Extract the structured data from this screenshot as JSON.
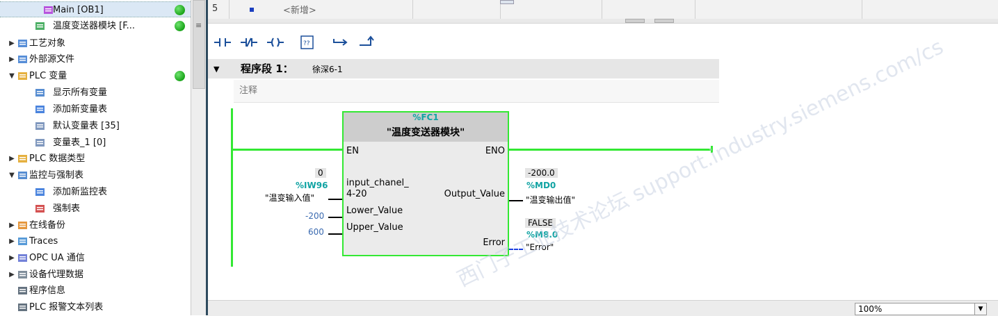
{
  "tree": {
    "items": [
      {
        "label": "Main [OB1]",
        "icon": "ob-block-icon",
        "selected": true,
        "dot": true
      },
      {
        "label": "温度变送器模块 [F...",
        "icon": "fc-block-icon",
        "dot": true
      },
      {
        "label": "工艺对象",
        "icon": "technology-objects-icon",
        "twisty": "▶"
      },
      {
        "label": "外部源文件",
        "icon": "external-source-icon",
        "twisty": "▶"
      },
      {
        "label": "PLC 变量",
        "icon": "plc-tags-folder-icon",
        "twisty": "▼",
        "dot": true
      },
      {
        "label": "显示所有变量",
        "icon": "show-all-tags-icon"
      },
      {
        "label": "添加新变量表",
        "icon": "add-tag-table-icon"
      },
      {
        "label": "默认变量表 [35]",
        "icon": "tag-table-icon"
      },
      {
        "label": "变量表_1 [0]",
        "icon": "tag-table-icon"
      },
      {
        "label": "PLC 数据类型",
        "icon": "plc-datatype-icon",
        "twisty": "▶"
      },
      {
        "label": "监控与强制表",
        "icon": "watch-table-folder-icon",
        "twisty": "▼"
      },
      {
        "label": "添加新监控表",
        "icon": "add-watch-table-icon"
      },
      {
        "label": "强制表",
        "icon": "force-table-icon"
      },
      {
        "label": "在线备份",
        "icon": "online-backup-icon",
        "twisty": "▶"
      },
      {
        "label": "Traces",
        "icon": "traces-icon",
        "twisty": "▶"
      },
      {
        "label": "OPC UA 通信",
        "icon": "opc-ua-icon",
        "twisty": "▶"
      },
      {
        "label": "设备代理数据",
        "icon": "device-proxy-icon",
        "twisty": "▶"
      },
      {
        "label": "程序信息",
        "icon": "program-info-icon"
      },
      {
        "label": "PLC 报警文本列表",
        "icon": "alarm-text-icon"
      }
    ]
  },
  "interface": {
    "row_number": "5",
    "new_label": "<新增>"
  },
  "toolbar": {
    "buttons": [
      "no-contact",
      "nc-contact",
      "coil",
      "empty-box",
      "open-branch",
      "close-branch"
    ]
  },
  "network": {
    "title": "程序段 1：",
    "subtitle": "徐深6-1",
    "comment": "注释",
    "block": {
      "address": "%FC1",
      "name": "\"温度变送器模块\"",
      "en": "EN",
      "eno": "ENO",
      "in1_line1": "input_chanel_",
      "in1_line2": "4-20",
      "in2": "Lower_Value",
      "in3": "Upper_Value",
      "out1": "Output_Value",
      "out2": "Error"
    },
    "in1_value": "0",
    "in1_address": "%IW96",
    "in1_tag": "\"温变输入值\"",
    "in2_value": "-200",
    "in3_value": "600",
    "out1_value": "-200.0",
    "out1_address": "%MD0",
    "out1_tag": "\"温变输出值\"",
    "out2_value": "FALSE",
    "out2_address": "%M8.0",
    "out2_tag": "\"Error\"",
    "watermark": "西门子工业技术论坛 support.industry.siemens.com/cs"
  },
  "status": {
    "zoom": "100%"
  }
}
